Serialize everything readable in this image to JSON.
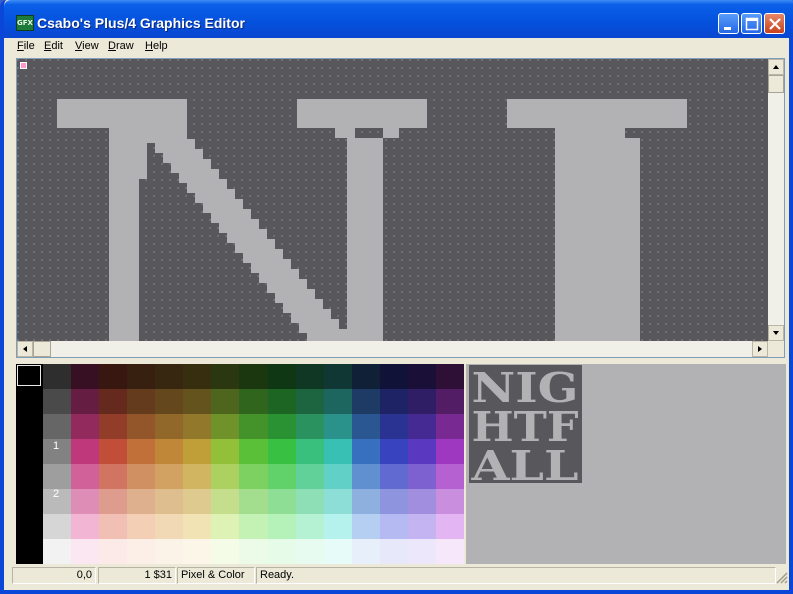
{
  "window": {
    "title": "Csabo's Plus/4 Graphics Editor",
    "icon_text": "GFX",
    "icon_name": "gfx-app-icon"
  },
  "menu": [
    {
      "label": "File",
      "accel": "F"
    },
    {
      "label": "Edit",
      "accel": "E"
    },
    {
      "label": "View",
      "accel": "V"
    },
    {
      "label": "Draw",
      "accel": "D"
    },
    {
      "label": "Help",
      "accel": "H"
    }
  ],
  "canvas": {
    "background": "#58585c",
    "foreground": "#b2b1b4",
    "cursor_color": "#ff99cc"
  },
  "palette": {
    "labels": [
      "1",
      "2"
    ],
    "selected_color": "#000000"
  },
  "preview": {
    "lines": [
      "NIG",
      "HTF",
      "ALL"
    ]
  },
  "status": {
    "coords": "0,0",
    "color_info": "1 $31",
    "mode": "Pixel & Color",
    "message": "Ready."
  }
}
